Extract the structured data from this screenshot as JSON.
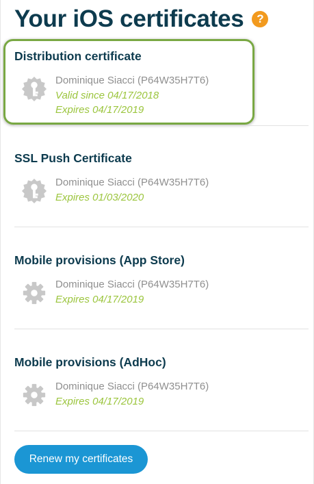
{
  "header": {
    "title": "Your iOS certificates",
    "help_glyph": "?",
    "help_color": "#f29a1e"
  },
  "sections": [
    {
      "title": "Distribution certificate",
      "icon": "key-certificate-icon",
      "owner": "Dominique Siacci (P64W35H7T6)",
      "valid_since": "Valid since 04/17/2018",
      "expires": "Expires 04/17/2019",
      "highlighted": true
    },
    {
      "title": "SSL Push Certificate",
      "icon": "key-certificate-icon",
      "owner": "Dominique Siacci (P64W35H7T6)",
      "expires": "Expires 01/03/2020"
    },
    {
      "title": "Mobile provisions (App Store)",
      "icon": "gear-icon",
      "owner": "Dominique Siacci (P64W35H7T6)",
      "expires": "Expires 04/17/2019"
    },
    {
      "title": "Mobile provisions (AdHoc)",
      "icon": "gear-icon",
      "owner": "Dominique Siacci (P64W35H7T6)",
      "expires": "Expires 04/17/2019"
    }
  ],
  "actions": {
    "renew_label": "Renew my certificates"
  },
  "colors": {
    "title": "#0d3b4e",
    "valid_text": "#9bc53d",
    "owner_text": "#8f8f8f",
    "button": "#1b96d4",
    "highlight_border": "#79a843",
    "icon": "#c8c8c8"
  }
}
